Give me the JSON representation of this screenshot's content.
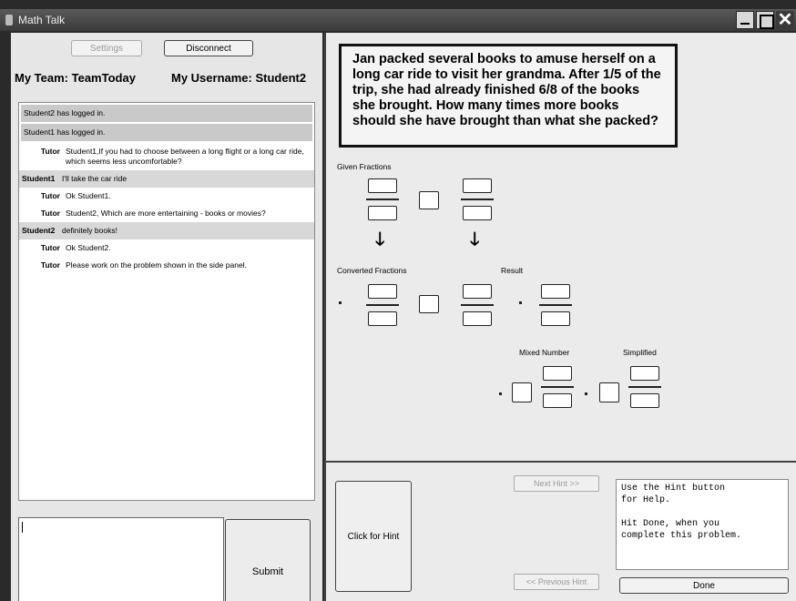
{
  "window": {
    "title": "Math Talk"
  },
  "left": {
    "settings_label": "Settings",
    "disconnect_label": "Disconnect",
    "team": "My Team: TeamToday",
    "username": "My Username: Student2",
    "submit_label": "Submit"
  },
  "chat": [
    {
      "kind": "sys",
      "who": "",
      "text": "Student2 has logged in."
    },
    {
      "kind": "sys",
      "who": "",
      "text": "Student1 has logged in."
    },
    {
      "kind": "tutor",
      "who": "Tutor",
      "text": "Student1,If you had to choose between a long flight or a long car ride, which seems less uncomfortable?"
    },
    {
      "kind": "student",
      "who": "Student1",
      "text": "I'll take the car ride"
    },
    {
      "kind": "tutor",
      "who": "Tutor",
      "text": "Ok Student1."
    },
    {
      "kind": "tutor",
      "who": "Tutor",
      "text": "Student2, Which are more entertaining - books or movies?"
    },
    {
      "kind": "student",
      "who": "Student2",
      "text": "definitely books!"
    },
    {
      "kind": "tutor",
      "who": "Tutor",
      "text": "Ok Student2."
    },
    {
      "kind": "tutor",
      "who": "Tutor",
      "text": "Please work on the problem shown in the side panel."
    }
  ],
  "problem": {
    "text": "Jan packed several books to amuse herself on a long car ride to visit her grandma.  After 1/5 of the trip, she had already finished  6/8 of the books she brought.  How many times more books should she have brought than what she packed?",
    "given_label": "Given Fractions",
    "converted_label": "Converted Fractions",
    "result_label": "Result",
    "mixed_label": "Mixed Number",
    "simplified_label": "Simplified"
  },
  "hint": {
    "click_label": "Click for Hint",
    "next_label": "Next Hint >>",
    "prev_label": "<< Previous Hint",
    "message": "Use the Hint button\nfor Help.\n\nHit Done, when you\ncomplete this problem.",
    "done_label": "Done"
  }
}
